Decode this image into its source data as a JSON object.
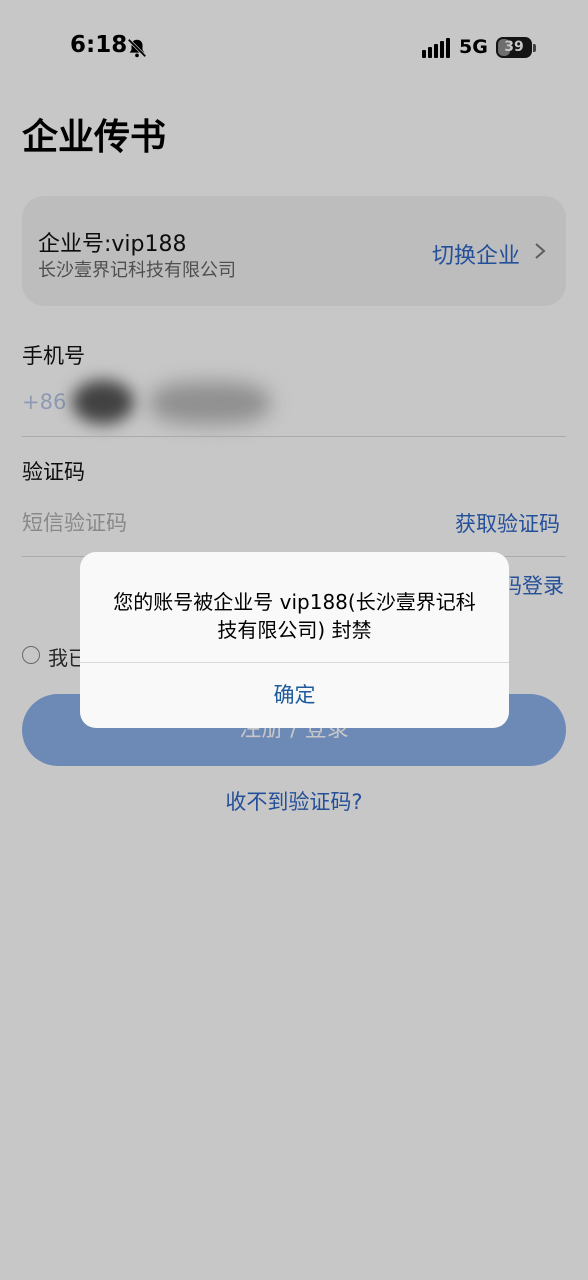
{
  "status_bar": {
    "time": "6:18",
    "network": "5G",
    "battery_level": "39",
    "battery_fraction": 0.39,
    "icons": [
      "bell-slash-icon",
      "signal-bars-icon"
    ]
  },
  "app": {
    "title": "企业传书"
  },
  "company_card": {
    "company_id": "企业号:vip188",
    "company_name": "长沙壹界记科技有限公司",
    "switch_label": "切换企业"
  },
  "form": {
    "phone_label": "手机号",
    "phone_prefix": "+86",
    "code_label": "验证码",
    "code_placeholder": "短信验证码",
    "get_code_label": "获取验证码",
    "password_login_label": "码登录",
    "agree_text": "我已",
    "submit_label": "注册 / 登录",
    "no_code_link": "收不到验证码?"
  },
  "alert": {
    "message": "您的账号被企业号 vip188(长沙壹界记科技有限公司) 封禁",
    "confirm_label": "确定"
  },
  "colors": {
    "accent": "#2f67c5",
    "button": "#8cb0ea",
    "dialog_button_text": "#1e5a9c"
  }
}
